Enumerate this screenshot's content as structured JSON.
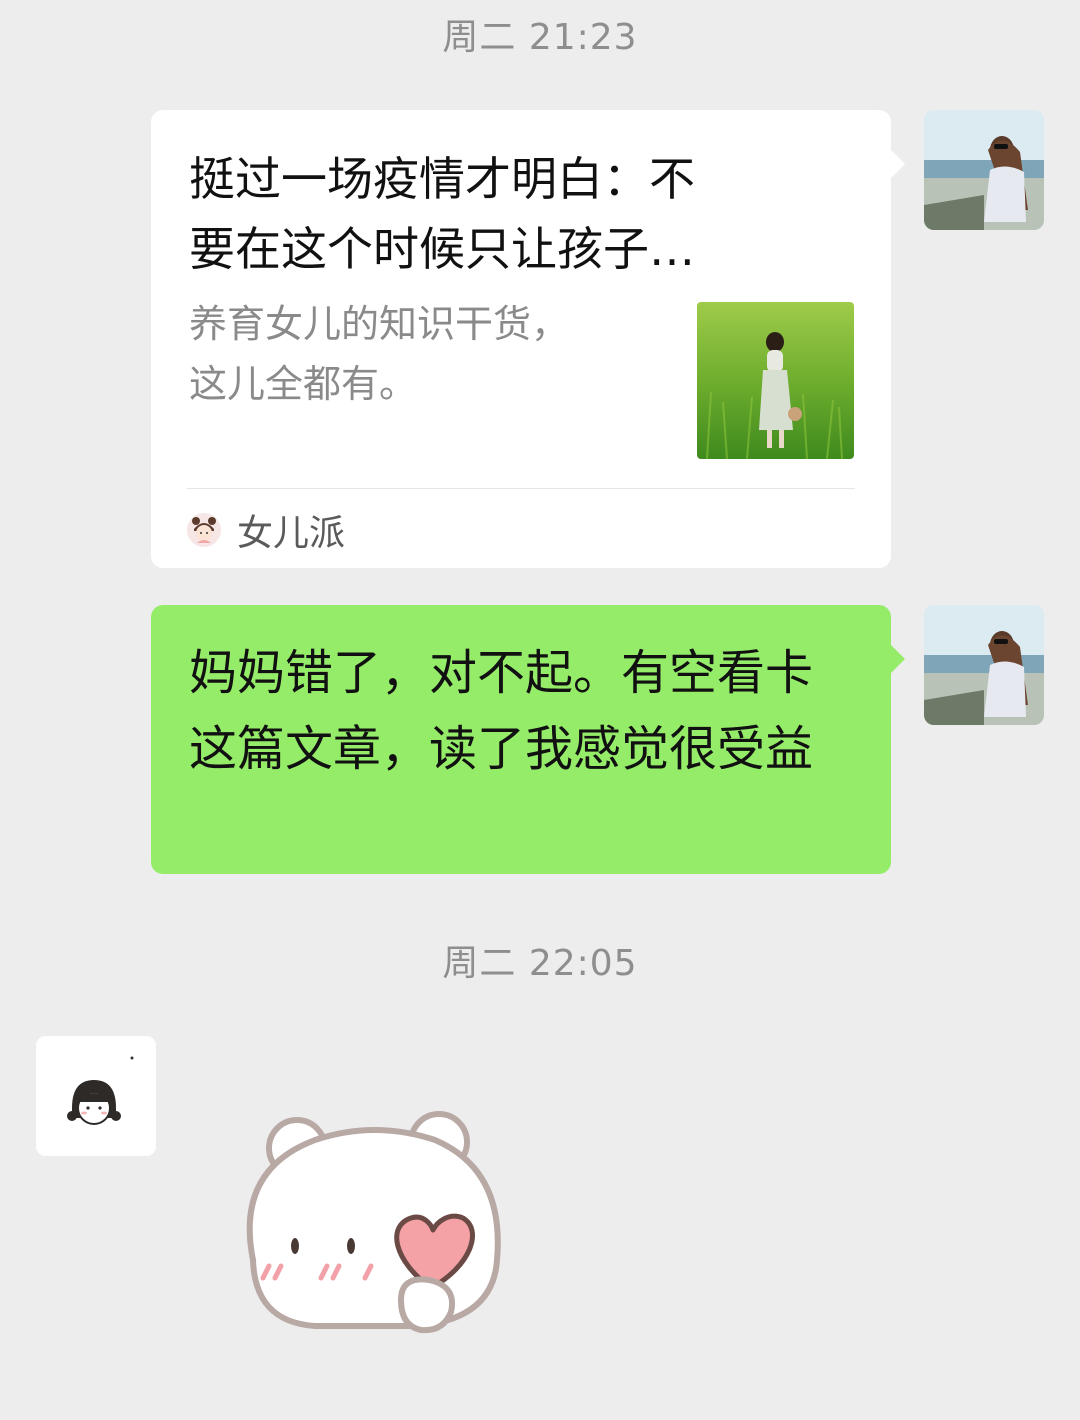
{
  "messages": [
    {
      "timestamp": "周二  21:23"
    },
    {
      "timestamp": "周二  22:05"
    }
  ],
  "article_card": {
    "title": "挺过一场疫情才明白：不\n要在这个时候只让孩子…",
    "description": "养育女儿的知识干货，\n这儿全都有。",
    "source_name": "女儿派",
    "thumbnail_icon": "girl-in-field-photo",
    "source_icon": "girl-face-icon"
  },
  "text_message": {
    "text": "妈妈错了，对不起。有空看卡这篇文章，读了我感觉很受益"
  },
  "colors": {
    "background": "#EDEDED",
    "sent_bubble": "#95EC69",
    "card_bubble": "#FFFFFF",
    "timestamp": "#8E8E8E"
  },
  "icons": {
    "self_avatar": "woman-at-beach-avatar",
    "other_avatar": "cartoon-girl-moon-avatar",
    "sticker": "bear-holding-heart-sticker"
  }
}
